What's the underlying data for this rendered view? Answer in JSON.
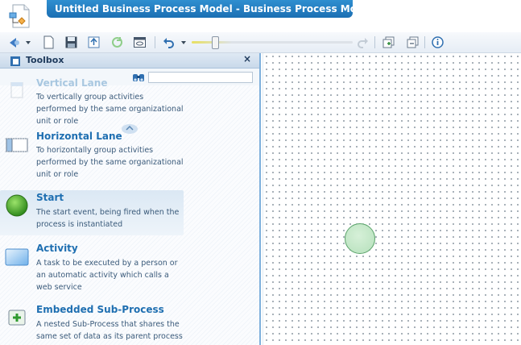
{
  "window": {
    "title": "Untitled Business Process Model - Business Process Model*",
    "app_icon": "process-model-icon"
  },
  "toolbar": {
    "icons": [
      "appearance-icon",
      "chevron-down-icon",
      "new-document-icon",
      "save-icon",
      "export-icon",
      "refresh-icon",
      "preview-icon",
      "undo-icon",
      "chevron-down-icon",
      "redo-icon",
      "expand-icon",
      "collapse-icon",
      "info-icon"
    ],
    "zoom_level": 0.15
  },
  "toolbox": {
    "title": "Toolbox",
    "close_label": "×",
    "search_placeholder": "",
    "items": [
      {
        "name": "Vertical Lane",
        "description": "To vertically group activities performed by the same organizational unit or role",
        "icon": "vertical-lane-icon"
      },
      {
        "name": "Horizontal Lane",
        "description": "To horizontally group activities performed by the same organizational unit or role",
        "icon": "horizontal-lane-icon"
      },
      {
        "name": "Start",
        "description": "The start event, being fired when the process is instantiated",
        "icon": "start-event-icon"
      },
      {
        "name": "Activity",
        "description": "A task to be executed by a person or an automatic activity which calls a web service",
        "icon": "activity-icon"
      },
      {
        "name": "Embedded Sub-Process",
        "description": "A nested Sub-Process that shares the same set of data as its parent process",
        "icon": "subprocess-icon"
      }
    ]
  },
  "colors": {
    "title_bar": "#1b6fb3",
    "item_name": "#1f6fb1",
    "start_node_fill": "#c4e8c8",
    "start_node_stroke": "#5aa36a"
  }
}
